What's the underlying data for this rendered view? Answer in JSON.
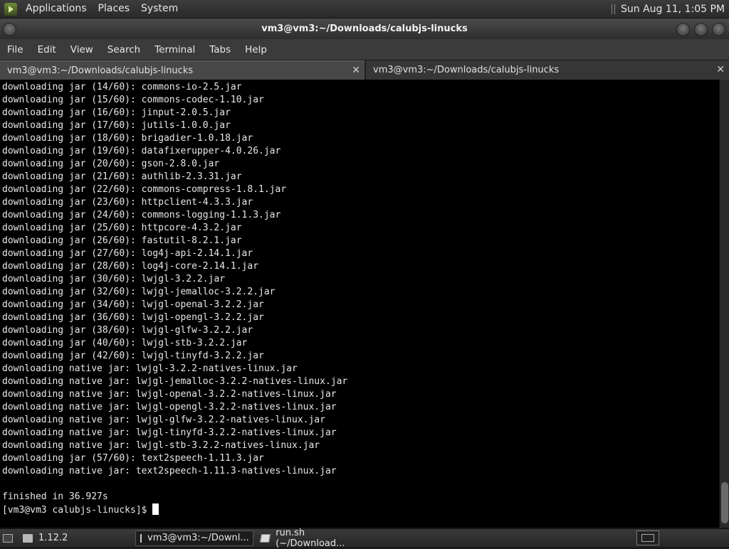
{
  "top_panel": {
    "menus": [
      "Applications",
      "Places",
      "System"
    ],
    "clock": "Sun Aug 11,  1:05 PM"
  },
  "window": {
    "title": "vm3@vm3:~/Downloads/calubjs-linucks"
  },
  "menubar": [
    "File",
    "Edit",
    "View",
    "Search",
    "Terminal",
    "Tabs",
    "Help"
  ],
  "tabs": [
    {
      "label": "vm3@vm3:~/Downloads/calubjs-linucks",
      "close": "✕",
      "active": true
    },
    {
      "label": "vm3@vm3:~/Downloads/calubjs-linucks",
      "close": "✕",
      "active": false
    }
  ],
  "terminal": {
    "lines": [
      "downloading jar (14/60): commons-io-2.5.jar",
      "downloading jar (15/60): commons-codec-1.10.jar",
      "downloading jar (16/60): jinput-2.0.5.jar",
      "downloading jar (17/60): jutils-1.0.0.jar",
      "downloading jar (18/60): brigadier-1.0.18.jar",
      "downloading jar (19/60): datafixerupper-4.0.26.jar",
      "downloading jar (20/60): gson-2.8.0.jar",
      "downloading jar (21/60): authlib-2.3.31.jar",
      "downloading jar (22/60): commons-compress-1.8.1.jar",
      "downloading jar (23/60): httpclient-4.3.3.jar",
      "downloading jar (24/60): commons-logging-1.1.3.jar",
      "downloading jar (25/60): httpcore-4.3.2.jar",
      "downloading jar (26/60): fastutil-8.2.1.jar",
      "downloading jar (27/60): log4j-api-2.14.1.jar",
      "downloading jar (28/60): log4j-core-2.14.1.jar",
      "downloading jar (30/60): lwjgl-3.2.2.jar",
      "downloading jar (32/60): lwjgl-jemalloc-3.2.2.jar",
      "downloading jar (34/60): lwjgl-openal-3.2.2.jar",
      "downloading jar (36/60): lwjgl-opengl-3.2.2.jar",
      "downloading jar (38/60): lwjgl-glfw-3.2.2.jar",
      "downloading jar (40/60): lwjgl-stb-3.2.2.jar",
      "downloading jar (42/60): lwjgl-tinyfd-3.2.2.jar",
      "downloading native jar: lwjgl-3.2.2-natives-linux.jar",
      "downloading native jar: lwjgl-jemalloc-3.2.2-natives-linux.jar",
      "downloading native jar: lwjgl-openal-3.2.2-natives-linux.jar",
      "downloading native jar: lwjgl-opengl-3.2.2-natives-linux.jar",
      "downloading native jar: lwjgl-glfw-3.2.2-natives-linux.jar",
      "downloading native jar: lwjgl-tinyfd-3.2.2-natives-linux.jar",
      "downloading native jar: lwjgl-stb-3.2.2-natives-linux.jar",
      "downloading jar (57/60): text2speech-1.11.3.jar",
      "downloading native jar: text2speech-1.11.3-natives-linux.jar",
      "",
      "finished in 36.927s"
    ],
    "prompt": "[vm3@vm3 calubjs-linucks]$ "
  },
  "taskbar": {
    "items": [
      {
        "label": "1.12.2",
        "icon": "folder-icon",
        "active": false
      },
      {
        "label": "vm3@vm3:~/Downl...",
        "icon": "terminal-icon",
        "active": true
      },
      {
        "label": "run.sh (~/Download...",
        "icon": "text-editor-icon",
        "active": false
      }
    ]
  }
}
